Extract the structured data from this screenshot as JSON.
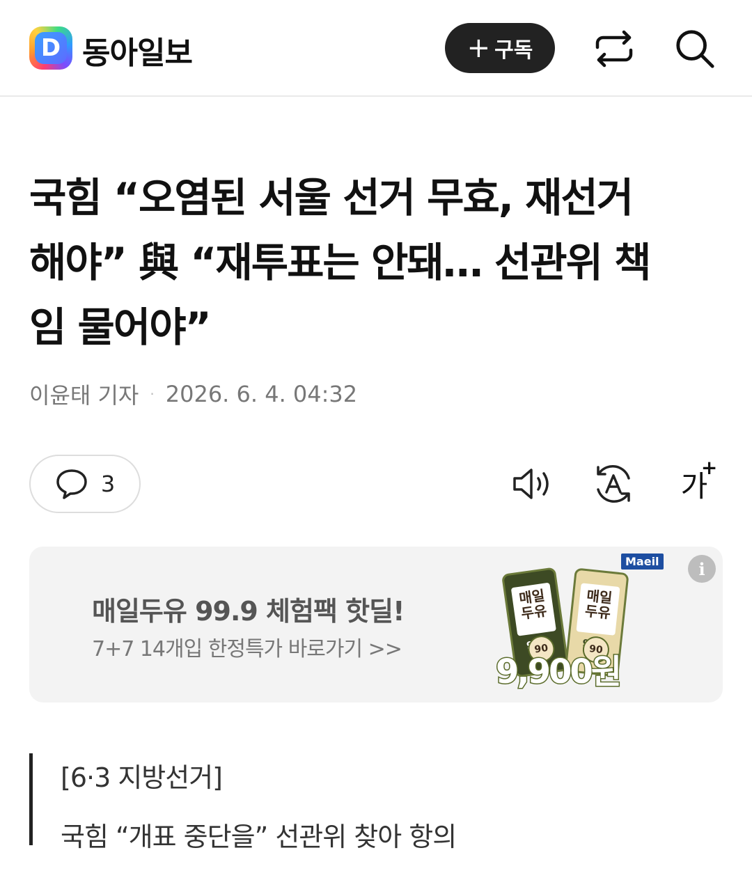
{
  "header": {
    "logo_letter": "D",
    "brand_name": "동아일보",
    "subscribe_label": "구독",
    "subscribe_plus": "+",
    "icons": [
      "share-icon",
      "search-icon"
    ]
  },
  "article": {
    "headline_lines": [
      "국힘 “오염된 서울 선거 무효, 재선거",
      "해야” 與 “재투표는 안돼… 선관위 책",
      "임 물어야”"
    ],
    "author": "이윤태 기자",
    "separator": "·",
    "datetime": "2026. 6. 4. 04:32"
  },
  "toolbar": {
    "comment_count": "3",
    "font_size_label": "가",
    "font_size_plus": "+",
    "icons": [
      "comment-icon",
      "speaker-icon",
      "translate-icon",
      "font-size-icon"
    ]
  },
  "ad": {
    "title": "매일두유 99.9 체험팩 핫딜!",
    "subtitle": "7+7 14개입 한정특가 바로가기 >>",
    "info_glyph": "i",
    "brand": "Maeil",
    "product_label": "매일 두유",
    "product_code": "99.9",
    "badge": "90",
    "price": "9,900원"
  },
  "related": {
    "tag": "[6·3 지방선거]",
    "title": "국힘 “개표 중단을” 선관위 찾아 항의"
  }
}
